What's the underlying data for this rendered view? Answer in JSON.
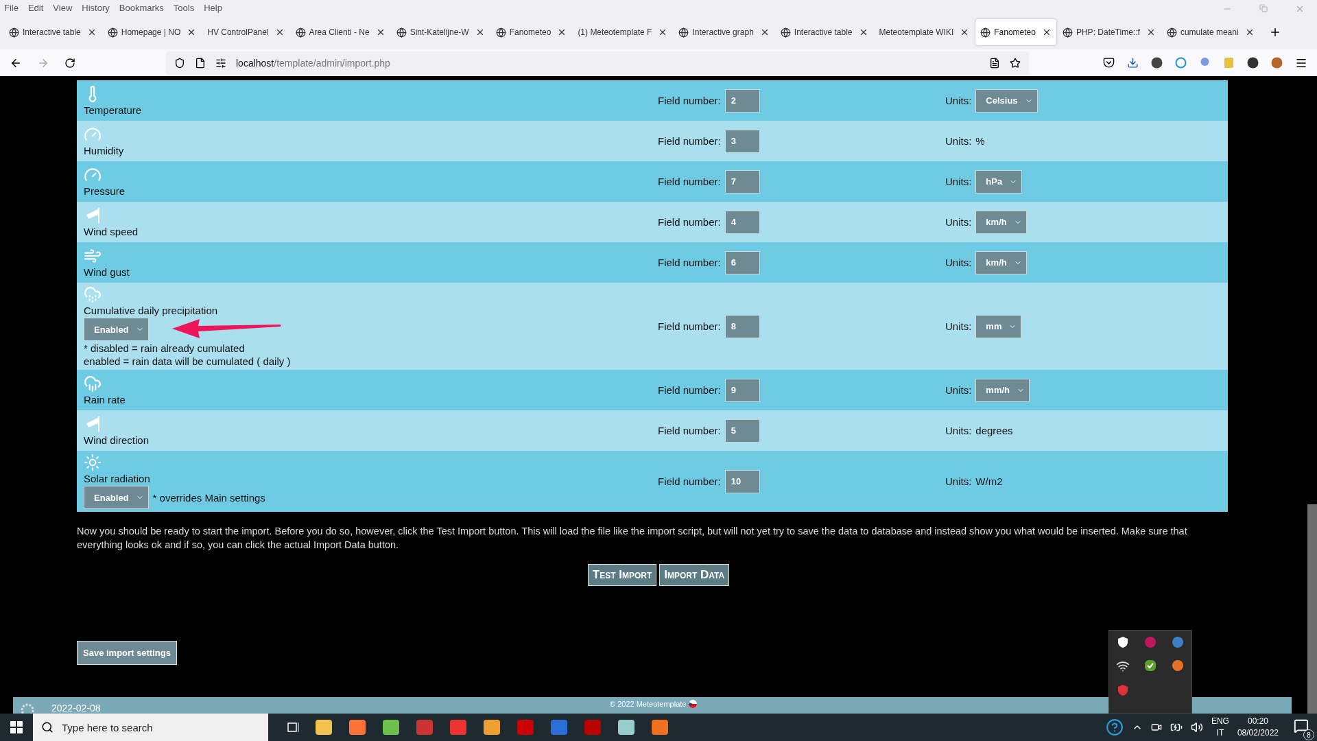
{
  "menu_bar": [
    "File",
    "Edit",
    "View",
    "History",
    "Bookmarks",
    "Tools",
    "Help"
  ],
  "tabs": [
    {
      "label": "Interactive table",
      "icon": true,
      "selected": false
    },
    {
      "label": "Homepage | NO",
      "icon": true,
      "selected": false
    },
    {
      "label": "HV ControlPanel",
      "icon": false,
      "selected": false
    },
    {
      "label": "Area Clienti - Ne",
      "icon": true,
      "selected": false
    },
    {
      "label": "Sint-Katelijne-W",
      "icon": true,
      "selected": false
    },
    {
      "label": "Fanometeo",
      "icon": true,
      "selected": false
    },
    {
      "label": "(1) Meteotemplate F",
      "icon": false,
      "selected": false
    },
    {
      "label": "Interactive graph",
      "icon": true,
      "selected": false
    },
    {
      "label": "Interactive table",
      "icon": true,
      "selected": false
    },
    {
      "label": "Meteotemplate WIKI",
      "icon": false,
      "selected": false
    },
    {
      "label": "Fanometeo",
      "icon": true,
      "selected": true
    },
    {
      "label": "PHP: DateTime::f",
      "icon": true,
      "selected": false
    },
    {
      "label": "cumulate meani",
      "icon": true,
      "selected": false
    }
  ],
  "address_bar": {
    "host": "localhost",
    "path": "/template/admin/import.php"
  },
  "fields": [
    {
      "name": "Temperature",
      "field_label": "Field number:",
      "field_number": "2",
      "units": {
        "kind": "select",
        "label": "Units:",
        "value": "Celsius"
      }
    },
    {
      "name": "Humidity",
      "field_label": "Field number:",
      "field_number": "3",
      "units": {
        "kind": "text",
        "label": "Units:",
        "value": "%"
      }
    },
    {
      "name": "Pressure",
      "field_label": "Field number:",
      "field_number": "7",
      "units": {
        "kind": "select",
        "label": "Units:",
        "value": "hPa"
      }
    },
    {
      "name": "Wind speed",
      "field_label": "Field number:",
      "field_number": "4",
      "units": {
        "kind": "select",
        "label": "Units:",
        "value": "km/h"
      }
    },
    {
      "name": "Wind gust",
      "field_label": "Field number:",
      "field_number": "6",
      "units": {
        "kind": "select",
        "label": "Units:",
        "value": "km/h"
      }
    },
    {
      "name": "Cumulative daily precipitation",
      "toggle": "Enabled",
      "notes": [
        "* disabled = rain already cumulated",
        "enabled = rain data will be cumulated ( daily )"
      ],
      "field_label": "Field number:",
      "field_number": "8",
      "units": {
        "kind": "select",
        "label": "Units:",
        "value": "mm"
      }
    },
    {
      "name": "Rain rate",
      "field_label": "Field number:",
      "field_number": "9",
      "units": {
        "kind": "select",
        "label": "Units:",
        "value": "mm/h"
      }
    },
    {
      "name": "Wind direction",
      "field_label": "Field number:",
      "field_number": "5",
      "units": {
        "kind": "text",
        "label": "Units:",
        "value": "degrees"
      }
    },
    {
      "name": "Solar radiation",
      "toggle": "Enabled",
      "inline_note": "* overrides Main settings",
      "field_label": "Field number:",
      "field_number": "10",
      "units": {
        "kind": "text",
        "label": "Units:",
        "value": "W/m2"
      }
    }
  ],
  "instructions": "Now you should be ready to start the import. Before you do so, however, click the Test Import button. This will load the file like the import script, but will not yet try to save the data to database and instead show you what would be inserted. Make sure that everything looks ok and if so, you can click the actual Import Data button.",
  "actions": [
    "Test Import",
    "Import Data"
  ],
  "save_button": "Save import settings",
  "footer": {
    "date": "2022-02-08",
    "copyright": "© 2022 Meteotemplate"
  },
  "taskbar": {
    "search_placeholder": "Type here to search",
    "language": [
      "ENG",
      "IT"
    ],
    "time": "00:20",
    "date": "08/02/2022",
    "notifications": "8"
  }
}
